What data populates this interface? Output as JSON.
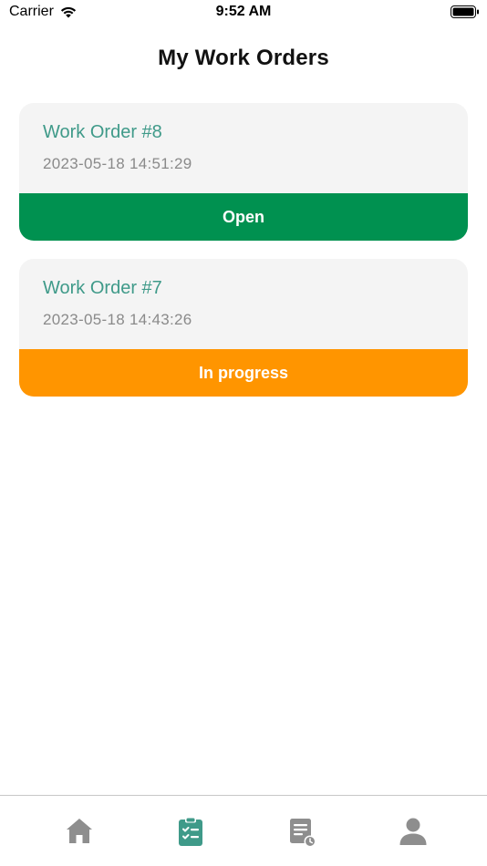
{
  "status_bar": {
    "carrier": "Carrier",
    "time": "9:52 AM"
  },
  "header": {
    "title": "My Work Orders"
  },
  "orders": [
    {
      "title": "Work Order #8",
      "date": "2023-05-18 14:51:29",
      "status": "Open",
      "status_color": "#009150"
    },
    {
      "title": "Work Order #7",
      "date": "2023-05-18 14:43:26",
      "status": "In progress",
      "status_color": "#ff9500"
    }
  ],
  "colors": {
    "accent": "#3f9a89",
    "tab_inactive": "#8e8e8e",
    "card_background": "#f4f4f4"
  },
  "tab_bar": {
    "tabs": [
      {
        "icon": "home-icon",
        "active": false
      },
      {
        "icon": "clipboard-checklist-icon",
        "active": true
      },
      {
        "icon": "document-history-icon",
        "active": false
      },
      {
        "icon": "person-icon",
        "active": false
      }
    ]
  }
}
